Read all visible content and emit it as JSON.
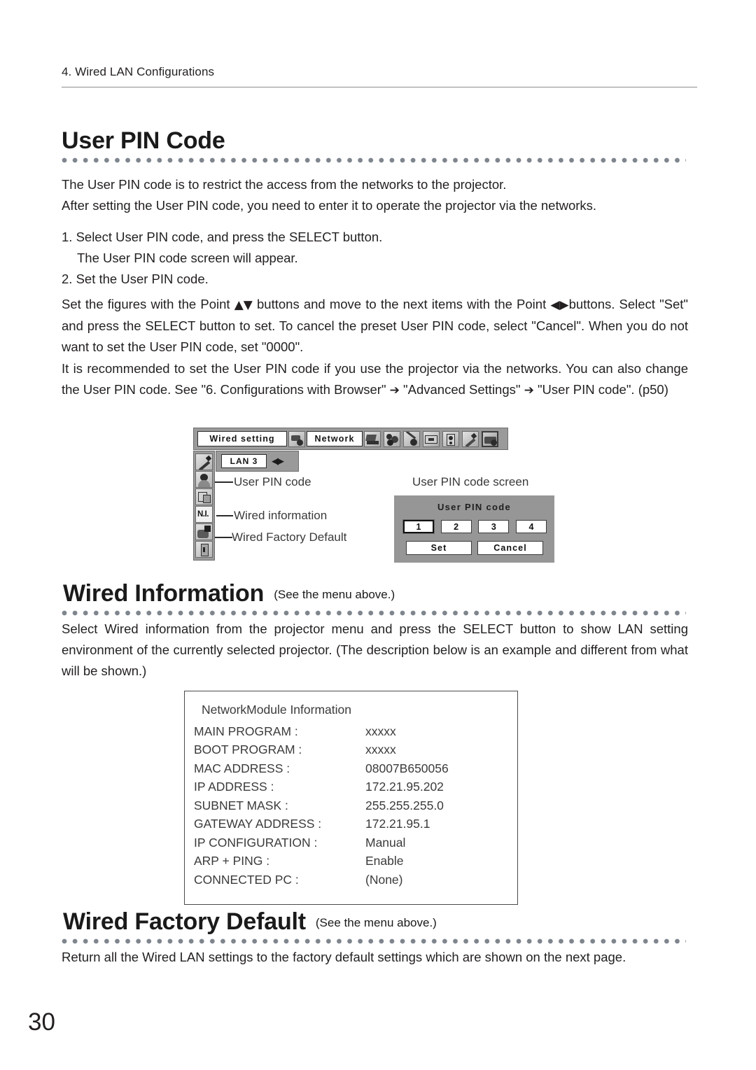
{
  "running_head": "4. Wired LAN Configurations",
  "page_number": "30",
  "sections": [
    {
      "id": "user-pin-code",
      "title": "User PIN Code",
      "note": ""
    },
    {
      "id": "wired-information",
      "title": "Wired Information",
      "note": "(See the menu above.)"
    },
    {
      "id": "wired-factory-default",
      "title": "Wired Factory Default",
      "note": "(See the menu above.)"
    }
  ],
  "paragraphs": {
    "intro_line1": "The User PIN code is to restrict the access from the networks to the projector.",
    "intro_line2": "After setting the User PIN code, you need to enter it to operate the projector via the networks.",
    "step1": "1. Select User PIN code, and press the SELECT button.",
    "step1_sub": "The User PIN code screen will appear.",
    "step2": "2. Set the User PIN code.",
    "set_figures_a": "Set the figures with the Point ",
    "set_figures_updown": "▲▼",
    "set_figures_b": " buttons and move to the next items with the Point ",
    "set_figures_left": "◀",
    "set_figures_right": "▶",
    "set_figures_c": "buttons.  Select \"Set\" and press the SELECT button to set.  To cancel the preset User PIN code, select \"Cancel\".  When you do not want to set the User PIN code, set \"0000\".",
    "recommend_a": "It is recommended to set the User PIN code if you use the projector via the networks.  You can also change the User PIN code. See \"6. Configurations with Browser\" ",
    "recommend_arrow": "➔",
    "recommend_b": " \"Advanced Settings\" ",
    "recommend_c": " \"User PIN code\".  (p50)",
    "wired_info_body": "Select Wired information from the projector menu and press the SELECT button to show LAN setting environment of the currently selected projector.  (The description below is an example and different from what will be shown.)",
    "factory_default_body": "Return all the Wired LAN settings to the factory default settings which are shown on the next page."
  },
  "osd_menu": {
    "wired_setting_label": "Wired setting",
    "network_label": "Network",
    "lan_label": "LAN 3",
    "lan_arrows": "◀▶",
    "top_icons": [
      "network-module-icon",
      "display-icon",
      "color-adjust-icon",
      "sound-icon",
      "screen-icon",
      "setting-panel-icon",
      "pointer-icon",
      "network-selected-icon"
    ],
    "side_icons": [
      "pointer-tool-icon",
      "user-pin-code-icon",
      "wired-setting-icon",
      "network-info-icon",
      "wired-factory-default-icon",
      "exit-icon"
    ],
    "callouts": [
      "User PIN code",
      "Wired information",
      "Wired Factory Default"
    ]
  },
  "pin_screen": {
    "caption": "User PIN code screen",
    "title": "User PIN code",
    "digits": [
      "1",
      "2",
      "3",
      "4"
    ],
    "set_label": "Set",
    "cancel_label": "Cancel"
  },
  "network_module_info": {
    "title": "NetworkModule Information",
    "rows": [
      {
        "key": "MAIN PROGRAM :",
        "value": "xxxxx"
      },
      {
        "key": "BOOT PROGRAM :",
        "value": "xxxxx"
      },
      {
        "key": "MAC ADDRESS :",
        "value": "08007B650056"
      },
      {
        "key": "IP ADDRESS :",
        "value": "172.21.95.202"
      },
      {
        "key": "SUBNET MASK :",
        "value": "255.255.255.0"
      },
      {
        "key": "GATEWAY ADDRESS :",
        "value": "172.21.95.1"
      },
      {
        "key": "IP CONFIGURATION :",
        "value": "Manual"
      },
      {
        "key": "ARP + PING :",
        "value": "Enable"
      },
      {
        "key": "CONNECTED PC :",
        "value": "(None)"
      }
    ]
  },
  "colors": {
    "text": "#231f20",
    "dot_rule": "#7f858d",
    "osd_gray": "#9a9a9a",
    "osd_screen_gray": "#969696",
    "rule": "#8b8b8b"
  }
}
